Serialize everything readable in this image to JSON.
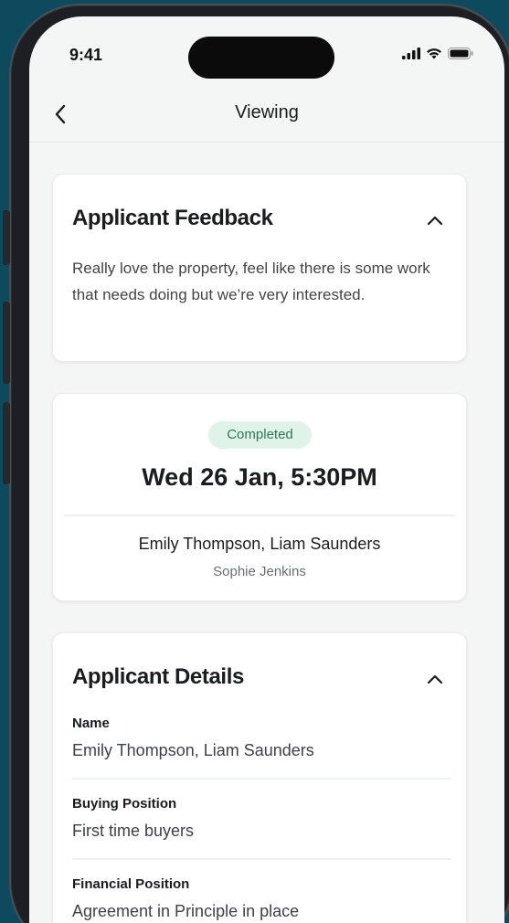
{
  "status_bar": {
    "time": "9:41"
  },
  "header": {
    "title": "Viewing"
  },
  "feedback_card": {
    "title": "Applicant Feedback",
    "text": "Really love the property, feel like there is some work that needs doing but we’re very interested."
  },
  "viewing_card": {
    "status": "Completed",
    "datetime": "Wed 26 Jan, 5:30PM",
    "applicants": "Emily Thompson, Liam Saunders",
    "agent": "Sophie Jenkins"
  },
  "details_card": {
    "title": "Applicant Details",
    "fields": [
      {
        "label": "Name",
        "value": "Emily Thompson, Liam Saunders"
      },
      {
        "label": "Buying Position",
        "value": "First time buyers"
      },
      {
        "label": "Financial Position",
        "value": "Agreement in Principle in place"
      }
    ]
  },
  "colors": {
    "background": "#0d4a5e",
    "badge_bg": "#dff3e8",
    "badge_text": "#2d7a52"
  }
}
